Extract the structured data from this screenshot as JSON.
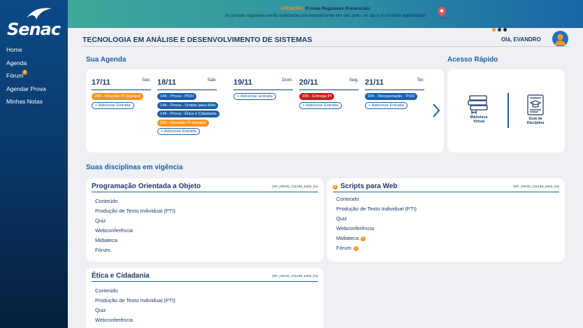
{
  "brand": {
    "logo_text": "Senac"
  },
  "sidebar": {
    "items": [
      {
        "label": "Home",
        "badge": ""
      },
      {
        "label": "Agenda",
        "badge": ""
      },
      {
        "label": "Fórum",
        "badge": "1"
      },
      {
        "label": "Agendar Prova",
        "badge": ""
      },
      {
        "label": "Minhas  Notas",
        "badge": ""
      }
    ]
  },
  "banner": {
    "attention": "ATENÇÃO:",
    "headline": "Provas Regulares Presenciais",
    "message": "As provas regulares serão realizadas presencialmente em seu polo, no dia e no horário agendados!",
    "slides": 3,
    "active_slide": 1
  },
  "header": {
    "course_title": "TECNOLOGIA EM ANÁLISE E DESENVOLVIMENTO DE SISTEMAS",
    "greeting": "Olá, EVANDRO"
  },
  "agenda": {
    "title": "Sua Agenda",
    "add_label": "+ Adicionar Entrada",
    "days": [
      {
        "date": "17/11",
        "weekday": "Sex.",
        "events": [
          {
            "text": "20h - Reunião PI (equipe)",
            "color": "orange"
          }
        ]
      },
      {
        "date": "18/11",
        "weekday": "Sáb.",
        "events": [
          {
            "text": "14h - Prova - POO",
            "color": "blue"
          },
          {
            "text": "14h - Prova - Scripts para Web",
            "color": "blue"
          },
          {
            "text": "14h - Prova - Ética e Cidadania",
            "color": "blue"
          },
          {
            "text": "20h - Reunião PI (equipe)",
            "color": "orange"
          }
        ]
      },
      {
        "date": "19/11",
        "weekday": "Dom.",
        "events": []
      },
      {
        "date": "20/11",
        "weekday": "Seg.",
        "events": [
          {
            "text": "20h - Entrega PI",
            "color": "red"
          }
        ]
      },
      {
        "date": "21/11",
        "weekday": "Ter.",
        "events": [
          {
            "text": "20h - Recuperação - POO",
            "color": "blue"
          }
        ]
      }
    ]
  },
  "quick_access": {
    "title": "Acesso Rápido",
    "items": [
      {
        "label_line1": "Biblioteca",
        "label_line2": "Virtual",
        "icon": "books-icon"
      },
      {
        "label_line1": "Guia da",
        "label_line2": "Disciplina",
        "icon": "discipline-guide-icon"
      }
    ]
  },
  "disciplines": {
    "title": "Suas disciplinas em vigência",
    "cards": [
      {
        "title": "Programação Orientada a Objeto",
        "code": "(SP_GRAD_711428_2403_01)",
        "title_badge": "",
        "links": [
          {
            "label": "Conteúdo",
            "badge": ""
          },
          {
            "label": "Produção de Texto Individual (PTI)",
            "badge": ""
          },
          {
            "label": "Quiz",
            "badge": ""
          },
          {
            "label": "Webconferência",
            "badge": ""
          },
          {
            "label": "Midiateca",
            "badge": ""
          },
          {
            "label": "Fórum",
            "badge": ""
          }
        ]
      },
      {
        "title": "Scripts para Web",
        "code": "(SP_GRAD_711428_2403_01)",
        "title_badge": "1",
        "links": [
          {
            "label": "Conteúdo",
            "badge": ""
          },
          {
            "label": "Produção de Texto Individual (PTI)",
            "badge": ""
          },
          {
            "label": "Quiz",
            "badge": ""
          },
          {
            "label": "Webconferência",
            "badge": ""
          },
          {
            "label": "Midiateca",
            "badge": "1"
          },
          {
            "label": "Fórum",
            "badge": "1"
          }
        ]
      },
      {
        "title": "Ética e Cidadania",
        "code": "(SP_GRAD_711428_2403_01)",
        "title_badge": "",
        "links": [
          {
            "label": "Conteúdo",
            "badge": ""
          },
          {
            "label": "Produção de Texto Individual (PTI)",
            "badge": ""
          },
          {
            "label": "Quiz",
            "badge": ""
          },
          {
            "label": "Webconferência",
            "badge": ""
          }
        ]
      }
    ]
  }
}
